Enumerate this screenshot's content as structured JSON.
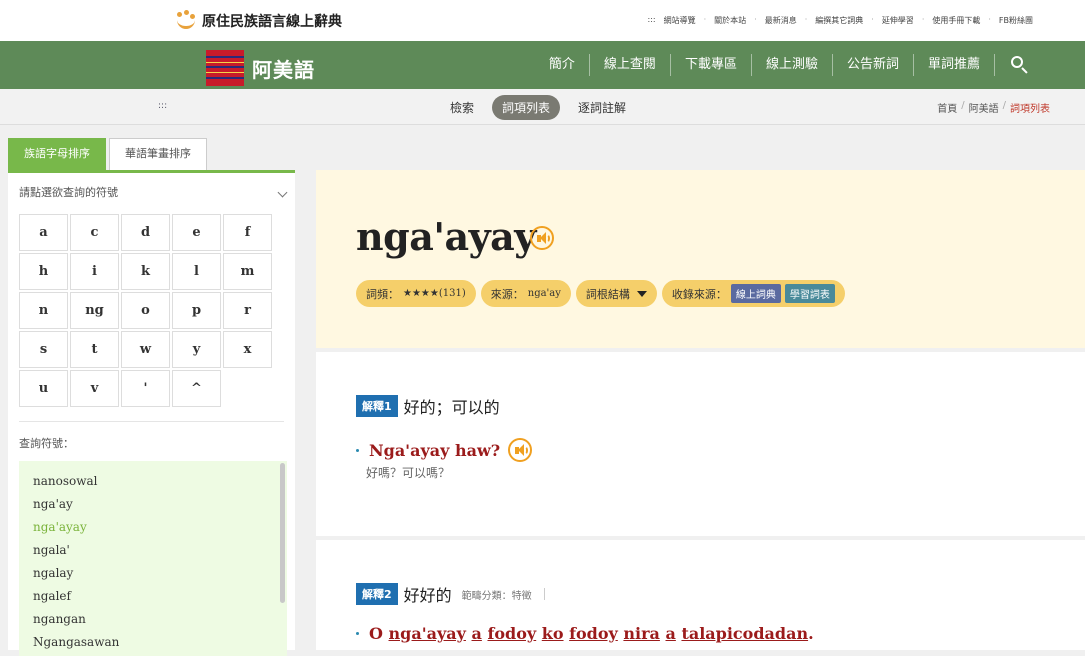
{
  "site": {
    "title": "原住民族語言線上辭典"
  },
  "toplinks": [
    ":::",
    "網站導覽",
    "關於本站",
    "最新消息",
    "編撰其它詞典",
    "延伸學習",
    "使用手冊下載",
    "FB粉絲團"
  ],
  "nav": {
    "language": "阿美語",
    "items": [
      "簡介",
      "線上查閱",
      "下載專區",
      "線上測驗",
      "公告新詞",
      "單詞推薦"
    ]
  },
  "subnav": {
    "accesskey": ":::",
    "tabs": [
      "檢索",
      "詞項列表",
      "逐詞註解"
    ],
    "active_tab": "詞項列表",
    "breadcrumb": [
      "首頁",
      "阿美語",
      "詞項列表"
    ]
  },
  "sidebar": {
    "tabs": [
      "族語字母排序",
      "華語筆畫排序"
    ],
    "prompt": "請點選欲查詢的符號",
    "letters": [
      "a",
      "c",
      "d",
      "e",
      "f",
      "h",
      "i",
      "k",
      "l",
      "m",
      "n",
      "ng",
      "o",
      "p",
      "r",
      "s",
      "t",
      "w",
      "y",
      "x",
      "u",
      "v",
      "'",
      "^"
    ],
    "query_label": "查詢符號：",
    "words": [
      "nanosowal",
      "nga'ay",
      "nga'ayay",
      "ngala'",
      "ngalay",
      "ngalef",
      "ngangan",
      "Ngangasawan"
    ],
    "selected_word": "nga'ayay"
  },
  "entry": {
    "word": "nga'ayay",
    "pills": {
      "class_label": "詞頻：",
      "class_value": "★★★★(131)",
      "source_label": "來源：",
      "source_value": "nga'ay",
      "root_label": "詞根結構",
      "collection_label": "收錄來源：",
      "tags": [
        "線上詞典",
        "學習詞表"
      ]
    },
    "definitions": [
      {
        "num": "解釋1",
        "text": "好的；可以的",
        "example": "Nga'ayay haw?",
        "translation": "好嗎？可以嗎？"
      },
      {
        "num": "解釋2",
        "text": "好好的",
        "category": "範疇分類：特徵",
        "example_words": [
          "O",
          "nga'ayay",
          "a",
          "fodoy",
          "ko",
          "fodoy",
          "nira",
          "a",
          "talapicodadan"
        ]
      }
    ]
  },
  "colors": {
    "nav_green": "#5e8a58",
    "accent_green": "#78b84a",
    "hero_bg": "#fff8e1",
    "pill": "#f5cf6a",
    "example_red": "#9b1b1b",
    "def_blue": "#1f6fb0"
  }
}
